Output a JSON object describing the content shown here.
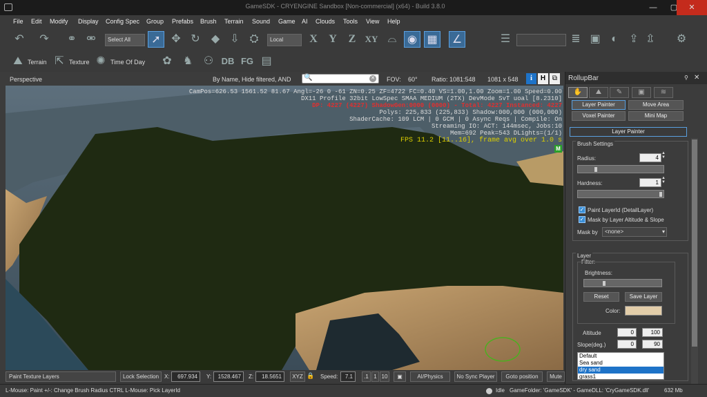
{
  "window": {
    "title": "GameSDK - CRYENGINE Sandbox [Non-commercial] (x64) - Build 3.8.0"
  },
  "menu": [
    "File",
    "Edit",
    "Modify",
    "Display",
    "Config Spec",
    "Group",
    "Prefabs",
    "Brush",
    "Terrain",
    "Sound",
    "Game",
    "AI",
    "Clouds",
    "Tools",
    "View",
    "Help"
  ],
  "toolbar": {
    "select_filter": "Select All",
    "coord_system": "Local",
    "axis_x": "X",
    "axis_y": "Y",
    "axis_z": "Z",
    "axis_xy": "XY",
    "terrain_label": "Terrain",
    "texture_label": "Texture",
    "timeofday_label": "Time Of Day",
    "db_label": "DB",
    "fg_label": "FG"
  },
  "viewport": {
    "name": "Perspective",
    "filter_text": "By Name, Hide filtered, AND",
    "fov_label": "FOV:",
    "fov_value": "60°",
    "ratio_label": "Ratio: 1081:548",
    "resolution": "1081 x 548",
    "btn_i": "i",
    "btn_h": "H",
    "stats": [
      "CamPos=626.53 1561.52 81.67 Angl=-26  0 -61 ZN=0.25 ZF=4722 FC=0.40 VS=1.00,1.00 Zoom=1.00 Speed=0.00",
      "DX11 Profile 32bit LowSpec SMAA MEDIUM (2TX) DevMode SvT uoal [8.2310]",
      "DP: 4227 (4227) ShadowGen:0000 (0000) - Total: 4227 Instanced: 4227",
      "Polys: 225,833 (225,833) Shadow:000,000 (000,000)",
      "ShaderCache: 109 LCM | 0 GCM | 0 Async Reqs | Compile: On",
      "Streaming IO: ACT: 144msec, Jobs:10",
      "Mem=692 Peak=543 DLights=(1/1)",
      "FPS 11.2 [11..16], frame avg over 1.0 s"
    ],
    "m_badge": "M"
  },
  "rollup": {
    "title": "RollupBar",
    "tabs": {
      "layer_painter": "Layer Painter",
      "move_area": "Move Area",
      "voxel_painter": "Voxel Painter",
      "mini_map": "Mini Map"
    },
    "section_title": "Layer Painter",
    "brush_settings": "Brush Settings",
    "radius_label": "Radius:",
    "radius_value": "4",
    "radius_slider": 0.2,
    "hardness_label": "Hardness:",
    "hardness_value": "1",
    "hardness_slider": 1.0,
    "paint_layer_id": "Paint LayerId (DetailLayer)",
    "mask_altitude": "Mask by Layer Altitude & Slope",
    "mask_by_label": "Mask by",
    "mask_by_value": "<none>",
    "layer_title": "Layer",
    "filter_title": "Filter:",
    "brightness_label": "Brightness:",
    "brightness_slider": 0.25,
    "reset_btn": "Reset",
    "save_layer_btn": "Save Layer",
    "color_label": "Color:",
    "color_value": "#e2cda9",
    "altitude_label": "Altitude",
    "altitude_min": "0",
    "altitude_max": "100",
    "slope_label": "Slope(deg.)",
    "slope_min": "0",
    "slope_max": "90",
    "layers": [
      "Default",
      "Sea sand",
      "dry sand",
      "grass1"
    ],
    "selected_layer": "dry sand"
  },
  "bottombar": {
    "mode": "Paint Texture Layers",
    "lock_selection": "Lock Selection",
    "x_label": "X:",
    "x_value": "697.934",
    "y_label": "Y:",
    "y_value": "1528.467",
    "z_label": "Z:",
    "z_value": "18.5651",
    "xyz": "XYZ",
    "speed_label": "Speed:",
    "speed_value": "7.1",
    "speed_01": ".1",
    "speed_1": "1",
    "speed_10": "10",
    "ai_physics": "AI/Physics",
    "no_sync": "No Sync Player",
    "goto_position": "Goto position",
    "mute": "Mute"
  },
  "statusbar": {
    "hint": "L-Mouse: Paint   +/-: Change Brush Radius   CTRL L-Mouse: Pick LayerId",
    "state": "Idle",
    "game_folder": "GameFolder: 'GameSDK' - GameDLL: 'CryGameSDK.dll'",
    "memory": "632 Mb"
  }
}
